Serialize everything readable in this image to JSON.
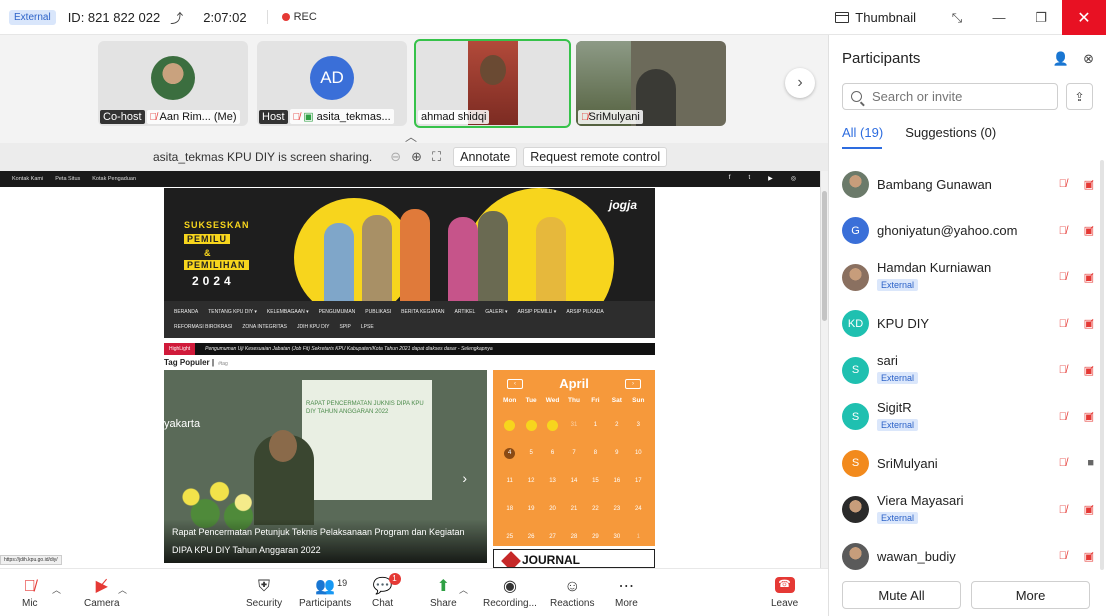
{
  "titlebar": {
    "external_badge": "External",
    "meeting_id": "ID: 821 822 022",
    "timer": "2:07:02",
    "rec_label": "REC",
    "thumbnail_label": "Thumbnail"
  },
  "strip": {
    "tiles": [
      {
        "role": "Co-host",
        "name": "Aan Rim...  (Me)"
      },
      {
        "role": "Host",
        "name": "asita_tekmas...",
        "initials": "AD"
      },
      {
        "role": "",
        "name": "ahmad shidqi"
      },
      {
        "role": "",
        "name": "SriMulyani"
      }
    ]
  },
  "sharebar": {
    "status": "asita_tekmas KPU DIY is screen sharing.",
    "annotate": "Annotate",
    "remote_control": "Request remote control"
  },
  "site": {
    "topbar_links": [
      "Kontak Kami",
      "Peta Situs",
      "Kotak Pengaduan"
    ],
    "social": [
      "f",
      "t",
      "▶",
      "◎"
    ],
    "banner_line1": "SUKSESKAN",
    "banner_line2": "PEMILU",
    "banner_line3": "&",
    "banner_line4": "PEMILIHAN",
    "banner_year": "2024",
    "banner_brand": "jogja",
    "nav_row1": [
      "BERANDA",
      "TENTANG KPU DIY ▾",
      "KELEMBAGAAN ▾",
      "PENGUMUMAN",
      "PUBLIKASI",
      "BERITA KEGIATAN",
      "ARTIKEL",
      "GALERI ▾",
      "ARSIP PEMILU ▾",
      "ARSIP PILKADA"
    ],
    "nav_row2": [
      "REFORMASI BIROKRASI",
      "ZONA INTEGRITAS",
      "JDIH KPU DIY",
      "SPIP",
      "LPSE"
    ],
    "highlight_tag": "HighLight",
    "highlight_text": "Pengumuman Uji Kesesuaian Jabatan (Job Fit) Sekretaris KPU Kabupaten/Kota Tahun 2021 dapat diakses dasar - Selengkapnya",
    "tag_populer": "Tag Populer |",
    "tag_item": "#tag",
    "slide_city": "yakarta",
    "slide_screen_text": "RAPAT PENCERMATAN JUKNIS DIPA KPU DIY TAHUN ANGGARAN 2022",
    "slide_caption": "Rapat Pencermatan Petunjuk Teknis Pelaksanaan Program dan Kegiatan DIPA KPU DIY Tahun Anggaran 2022",
    "calendar_month": "April",
    "calendar_days": [
      "Mon",
      "Tue",
      "Wed",
      "Thu",
      "Fri",
      "Sat",
      "Sun"
    ],
    "calendar_cells": [
      "",
      "",
      "",
      "31",
      "1",
      "2",
      "3",
      "4",
      "5",
      "6",
      "7",
      "8",
      "9",
      "10",
      "11",
      "12",
      "13",
      "14",
      "15",
      "16",
      "17",
      "18",
      "19",
      "20",
      "21",
      "22",
      "23",
      "24",
      "25",
      "26",
      "27",
      "28",
      "29",
      "30",
      "1"
    ],
    "journal": "JOURNAL",
    "status_url": "https://jdih.kpu.go.id/diy/"
  },
  "toolbar": {
    "mic": "Mic",
    "camera": "Camera",
    "security": "Security",
    "participants": "Participants",
    "participants_count": "19",
    "chat": "Chat",
    "chat_badge": "1",
    "share": "Share",
    "recording": "Recording...",
    "reactions": "Reactions",
    "more": "More",
    "leave": "Leave"
  },
  "panel": {
    "title": "Participants",
    "search_placeholder": "Search or invite",
    "tab_all": "All (19)",
    "tab_suggestions": "Suggestions (0)",
    "participants": [
      {
        "name": "Bambang Gunawan",
        "initial": "",
        "color": "#6b7a6a",
        "external": "",
        "cam_on": false
      },
      {
        "name": "ghoniyatun@yahoo.com",
        "initial": "G",
        "color": "#3a6fd8",
        "external": "",
        "cam_on": false
      },
      {
        "name": "Hamdan Kurniawan",
        "initial": "",
        "color": "#8a7060",
        "external": "External",
        "cam_on": false
      },
      {
        "name": "KPU DIY",
        "initial": "KD",
        "color": "#1fc0b0",
        "external": "",
        "cam_on": false
      },
      {
        "name": "sari",
        "initial": "S",
        "color": "#1fc0b0",
        "external": "External",
        "cam_on": false
      },
      {
        "name": "SigitR",
        "initial": "S",
        "color": "#1fc0b0",
        "external": "External",
        "cam_on": false
      },
      {
        "name": "SriMulyani",
        "initial": "S",
        "color": "#f28a1d",
        "external": "",
        "cam_on": true
      },
      {
        "name": "Viera Mayasari",
        "initial": "",
        "color": "#2a2a2a",
        "external": "External",
        "cam_on": false
      },
      {
        "name": "wawan_budiy",
        "initial": "",
        "color": "#5a5a5a",
        "external": "",
        "cam_on": false
      }
    ],
    "mute_all": "Mute All",
    "more": "More"
  },
  "colors": {
    "accent": "#2d6cdf",
    "active_speaker": "#36c24a",
    "danger": "#e53935",
    "calendar": "#f6993b"
  }
}
